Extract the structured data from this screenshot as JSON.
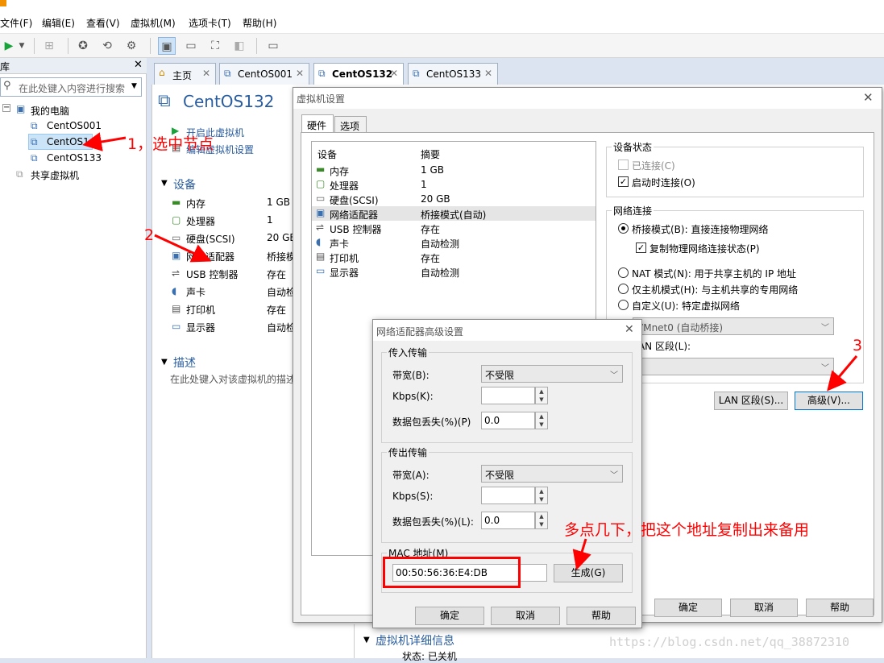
{
  "menu": {
    "items": [
      "文件(F)",
      "编辑(E)",
      "查看(V)",
      "虚拟机(M)",
      "选项卡(T)",
      "帮助(H)"
    ]
  },
  "library": {
    "header": "库",
    "search_placeholder": "在此处键入内容进行搜索",
    "tree": {
      "root": "我的电脑",
      "children": [
        "CentOS001",
        "CentOS1",
        "CentOS133"
      ],
      "shared": "共享虚拟机"
    }
  },
  "tabs": [
    {
      "label": "主页"
    },
    {
      "label": "CentOS001"
    },
    {
      "label": "CentOS132"
    },
    {
      "label": "CentOS133"
    }
  ],
  "vm": {
    "title": "CentOS132",
    "actions": [
      "开启此虚拟机",
      "编辑虚拟机设置"
    ],
    "devices_heading": "设备",
    "devices": [
      {
        "name": "内存",
        "value": "1 GB"
      },
      {
        "name": "处理器",
        "value": "1"
      },
      {
        "name": "硬盘(SCSI)",
        "value": "20 GB"
      },
      {
        "name": "网络适配器",
        "value": "桥接模"
      },
      {
        "name": "USB 控制器",
        "value": "存在"
      },
      {
        "name": "声卡",
        "value": "自动检"
      },
      {
        "name": "打印机",
        "value": "存在"
      },
      {
        "name": "显示器",
        "value": "自动检"
      }
    ],
    "desc_heading": "描述",
    "desc_placeholder": "在此处键入对该虚拟机的描述",
    "details_heading": "虚拟机详细信息",
    "state_label": "状态: 已关机"
  },
  "settings_dialog": {
    "title": "虚拟机设置",
    "tabs": [
      "硬件",
      "选项"
    ],
    "col_device": "设备",
    "col_summary": "摘要",
    "hardware": [
      {
        "name": "内存",
        "summary": "1 GB"
      },
      {
        "name": "处理器",
        "summary": "1"
      },
      {
        "name": "硬盘(SCSI)",
        "summary": "20 GB"
      },
      {
        "name": "网络适配器",
        "summary": "桥接模式(自动)"
      },
      {
        "name": "USB 控制器",
        "summary": "存在"
      },
      {
        "name": "声卡",
        "summary": "自动检测"
      },
      {
        "name": "打印机",
        "summary": "存在"
      },
      {
        "name": "显示器",
        "summary": "自动检测"
      }
    ],
    "device_status": {
      "heading": "设备状态",
      "connected": "已连接(C)",
      "connect_on_power": "启动时连接(O)"
    },
    "network": {
      "heading": "网络连接",
      "bridged": "桥接模式(B): 直接连接物理网络",
      "replicate": "复制物理网络连接状态(P)",
      "nat": "NAT 模式(N): 用于共享主机的 IP 地址",
      "hostonly": "仅主机模式(H): 与主机共享的专用网络",
      "custom": "自定义(U): 特定虚拟网络",
      "vmnet_value": "VMnet0 (自动桥接)",
      "lan_segment_label": "LAN 区段(L):",
      "lan_button": "LAN 区段(S)...",
      "advanced_button": "高级(V)..."
    },
    "buttons": {
      "ok": "确定",
      "cancel": "取消",
      "help": "帮助"
    }
  },
  "adv_dialog": {
    "title": "网络适配器高级设置",
    "incoming": {
      "heading": "传入传输",
      "bandwidth_label": "带宽(B):",
      "bandwidth_value": "不受限",
      "kbps_label": "Kbps(K):",
      "kbps_value": "",
      "loss_label": "数据包丢失(%)(P)",
      "loss_value": "0.0"
    },
    "outgoing": {
      "heading": "传出传输",
      "bandwidth_label": "带宽(A):",
      "bandwidth_value": "不受限",
      "kbps_label": "Kbps(S):",
      "kbps_value": "",
      "loss_label": "数据包丢失(%)(L):",
      "loss_value": "0.0"
    },
    "mac_label": "MAC 地址(M)",
    "mac_value": "00:50:56:36:E4:DB",
    "generate_button": "生成(G)",
    "buttons": {
      "ok": "确定",
      "cancel": "取消",
      "help": "帮助"
    }
  },
  "annotations": {
    "step1": "1，选中节点",
    "step2": "2",
    "step3": "3",
    "mac_note": "多点几下，把这个地址复制出来备用",
    "color": "#ff0000"
  },
  "watermark": "https://blog.csdn.net/qq_38872310"
}
